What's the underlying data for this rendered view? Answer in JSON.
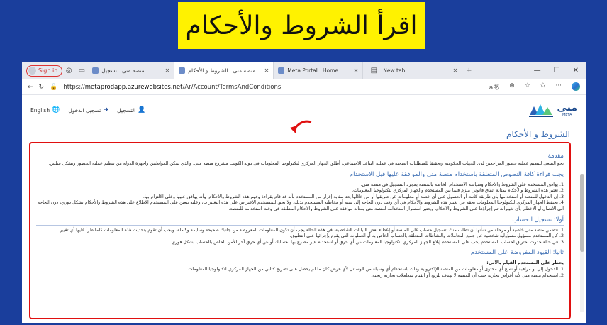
{
  "banner": {
    "text": "اقرأ الشروط والأحكام"
  },
  "browser": {
    "signin": "Sign in",
    "tabs": [
      {
        "label": "منصة متى ـ تسجيل",
        "active": false
      },
      {
        "label": "منصة متى ـ الشروط و الأحكام",
        "active": true
      },
      {
        "label": "Meta Portal ـ Home",
        "active": false
      },
      {
        "label": "New tab",
        "active": false
      }
    ],
    "url_prefix": "https://",
    "url_host": "metaprodapp.azurewebsites.net",
    "url_path": "/Ar/Account/TermsAndConditions",
    "zoom_badge": "aあ"
  },
  "site": {
    "lang": "English",
    "login": "تسجيل الدخول",
    "register": "التسجيل",
    "logo_text": "متى",
    "logo_sub": "META",
    "page_title": "الشروط و الأحكام"
  },
  "terms": {
    "intro_title": "مقدمة",
    "intro": "نحو السعي لتنظيم عملية حضور المراجعين لدى الجهات الحكومية وتحقيقا للمتطلبات الصحية في عملية التباعد الاجتماعي، أطلق الجهاز المركزي لتكنولوجيا المعلومات في دولة الكويت مشروع منصة متى، والذي يمكن المواطنين واجهزة الدولة من تنظيم عملية الحضور وبشكل سلس.",
    "s1_title": "يجب قراءة كافة النصوص المتعلقة باستخدام منصة متى والموافقة عليها قبل الاستخدام",
    "s1_items": [
      "1. يوافق المستخدم على الشروط والأحكام وسياسة الاستخدام الخاصة بالمنصة بمجرد التسجيل في منصة متى.",
      "2. تعتبر هذه الشروط والأحكام بمثابة اتفاق قانوني ملزم فيما بين المستخدم والجهاز المركزي لتكنولوجيا المعلومات.",
      "3. إن الدخول للمنصة أو استخدامها بأي طريقة كانت أو الحصول على أي خدمة أو معلومات عن طريقها أو من خلالها يعد بمثابة إقرار من المستخدم بأنه قد قام بقراءة وفهم هذه الشروط والأحكام، وأنه يوافق عليها وعلى الالتزام بها.",
      "4. يحتفظ الجهاز المركزي لتكنولوجيا المعلومات بحقه في تغيير هذه الشروط والأحكام في أي وقت دون الحاجة إلى تنبيه أو مخاطبة المستخدم بذلك، ولا يحق للمستخدم الاعتراض على هذه التغييرات، وعليه يتعين على المستخدم الاطلاع على هذه الشروط والأحكام بشكل دوري، دون الحاجة الى الاتصال او الاخطار بأي تغييرات تم إجراؤها على الشروط والأحكام، ويعتبر استمرار استخدامه لمنصة متى بمثابة موافقة على الشروط والأحكام المطبقة في وقت استخدامه للمنصة."
    ],
    "s2_title": "أولا: تسجيل الحساب",
    "s2_items": [
      "1. تتضمن منصة متى خاصية أو مرحلة من شأنها أن تطلب منك بتسجيل حساب على المنصة أو إعطاء بعض البيانات الشخصية، في هذه الحالة يجب أن تكون المعلومات المعروضة من جانبك صحيحة وسليمة وكاملة، ويجب أن تقوم بتحديث هذه المعلومات كلما طرأ عليها أي تغيير.",
      "2. كن المستخدم مسؤول مسؤولية شخصية عن جميع المعاملات والنشاطات المتعلقة بالحساب الخاص به أو العمليات التي يقوم بإجرائها على التطبيق.",
      "3. في حالة حدوث اختراق لحساب المستخدم يجب على المستخدم إبلاغ الجهاز المركزي لتكنولوجيا المعلومات عن أي خرق أو استخدام غير مصرح بها لحسابك أو عن أي خرق آخر للأمن الخاص بالحساب بشكل فوري."
    ],
    "s3_title": "ثانيا: القيود المفروضة على المستخدم",
    "s3_sub": "يحظر على المستخدم القيام بالآتي:",
    "s3_items": [
      "1. الدخول إلى أو مراقبة أو نسخ أي محتوى أو معلومات من المنصة الإلكترونية وذلك باستخدام أي وسيلة من الوسائل لأي غرض كان ما لم يحصل على تصريح كتابي من الجهاز المركزي لتكنولوجيا المعلومات.",
      "2. استخدام منصة متى لأية أغراض تجارية حيث أن المنصة لا تهدف للربح أو القيام بمعاملات تجارية ربحية."
    ]
  }
}
